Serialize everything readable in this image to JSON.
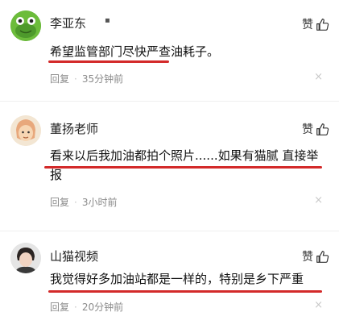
{
  "comments": [
    {
      "username": "李亚东",
      "extra": "▪",
      "like_label": "赞",
      "text": "希望监管部门尽快严查油耗子。",
      "reply_label": "回复",
      "time": "35分钟前",
      "close_glyph": "×"
    },
    {
      "username": "董扬老师",
      "like_label": "赞",
      "text": "看来以后我加油都拍个照片......如果有猫腻 直接举报",
      "reply_label": "回复",
      "time": "3小时前",
      "close_glyph": "×"
    },
    {
      "username": "山猫视频",
      "like_label": "赞",
      "text": "我觉得好多加油站都是一样的，特别是乡下严重",
      "reply_label": "回复",
      "time": "20分钟前",
      "close_glyph": "×"
    }
  ],
  "meta_separator": "·",
  "colors": {
    "underline": "#d32a2a",
    "meta": "#8a8a8a"
  }
}
